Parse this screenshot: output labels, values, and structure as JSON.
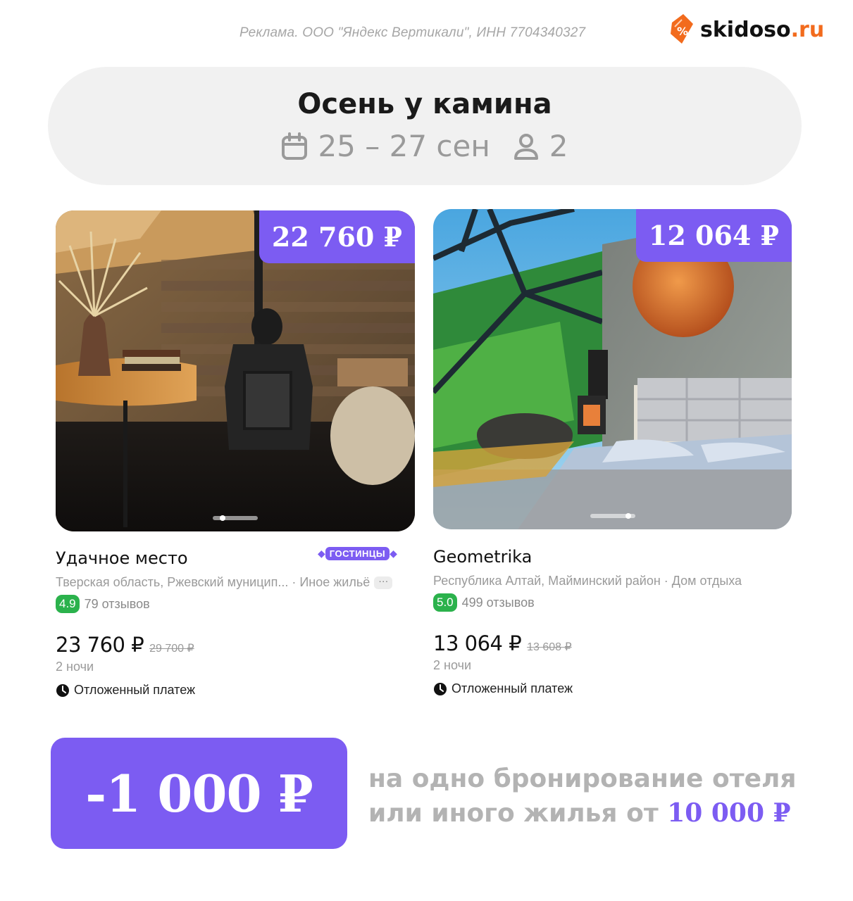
{
  "ad_note": "Реклама. ООО \"Яндекс Вертикали\", ИНН 7704340327",
  "logo": {
    "name": "skidoso",
    "suffix": ".ru",
    "icon": "discount-tag-icon",
    "accent": "#f26b1d"
  },
  "header": {
    "title": "Осень у камина",
    "dates": "25 – 27 сен",
    "guests": "2",
    "date_icon": "calendar-icon",
    "guest_icon": "person-icon"
  },
  "colors": {
    "accent": "#7c5cf2",
    "rating": "#2bb24c",
    "muted": "#9a9a9a",
    "pill_bg": "#f1f1f1"
  },
  "cards": [
    {
      "price_tag": "22 760 ₽",
      "name": "Удачное место",
      "badge": "ГОСТИНЦЫ",
      "location": "Тверская область, Ржевский муницип... · Иное жильё",
      "more": "···",
      "rating": "4.9",
      "reviews": "79 отзывов",
      "price": "23 760 ₽",
      "old_price": "29 700 ₽",
      "nights": "2 ночи",
      "payment": "Отложенный платеж",
      "photo_icon": "room-with-stove-photo"
    },
    {
      "price_tag": "12 064 ₽",
      "name": "Geometrika",
      "location": "Республика Алтай, Майминский район · Дом отдыха",
      "rating": "5.0",
      "reviews": "499 отзывов",
      "price": "13 064 ₽",
      "old_price": "13 608 ₽",
      "nights": "2 ночи",
      "payment": "Отложенный платеж",
      "photo_icon": "glass-dome-bedroom-photo"
    }
  ],
  "promo": {
    "discount": "-1 000 ₽",
    "line1": "на одно бронирование отеля",
    "line2": "или иного жилья от",
    "min_amount": "10 000 ₽"
  }
}
